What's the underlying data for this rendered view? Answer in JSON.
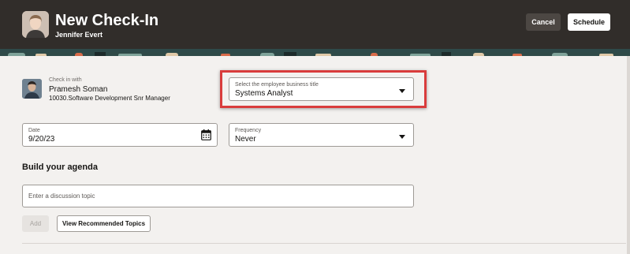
{
  "header": {
    "title": "New Check-In",
    "subtitle": "Jennifer Evert",
    "cancel_label": "Cancel",
    "schedule_label": "Schedule"
  },
  "checkin": {
    "label": "Check in with",
    "name": "Pramesh Soman",
    "role": "10030.Software Development Snr Manager"
  },
  "business_title": {
    "label": "Select the employee business title",
    "value": "Systems Analyst"
  },
  "date": {
    "label": "Date",
    "value": "9/20/23"
  },
  "frequency": {
    "label": "Frequency",
    "value": "Never"
  },
  "agenda": {
    "title": "Build your agenda",
    "topic_placeholder": "Enter a discussion topic",
    "add_label": "Add",
    "view_topics_label": "View Recommended Topics"
  },
  "colors": {
    "header_bg": "#312d2a",
    "page_bg": "#f3f1ef",
    "highlight": "#d93c3c"
  }
}
